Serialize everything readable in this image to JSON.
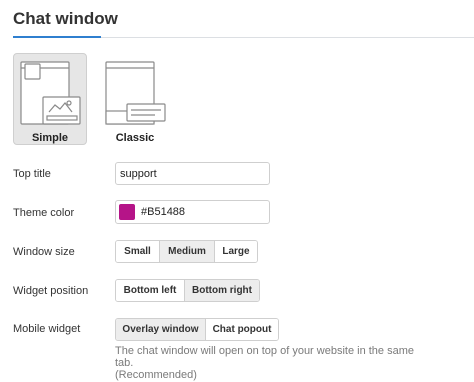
{
  "section": {
    "title": "Chat window",
    "accent_color": "#2f7fcf"
  },
  "layouts": {
    "selected": "Simple",
    "options": [
      {
        "label": "Simple"
      },
      {
        "label": "Classic"
      }
    ]
  },
  "top_title": {
    "label": "Top title",
    "value": "support"
  },
  "theme_color": {
    "label": "Theme color",
    "value": "#B51488",
    "swatch": "#B51488"
  },
  "window_size": {
    "label": "Window size",
    "selected": "Medium",
    "options": [
      "Small",
      "Medium",
      "Large"
    ]
  },
  "widget_position": {
    "label": "Widget position",
    "selected": "Bottom right",
    "options": [
      "Bottom left",
      "Bottom right"
    ]
  },
  "mobile_widget": {
    "label": "Mobile widget",
    "selected": "Overlay window",
    "options": [
      "Overlay window",
      "Chat popout"
    ],
    "help_line1": "The chat window will open on top of your website in the same tab.",
    "help_line2": "(Recommended)"
  }
}
